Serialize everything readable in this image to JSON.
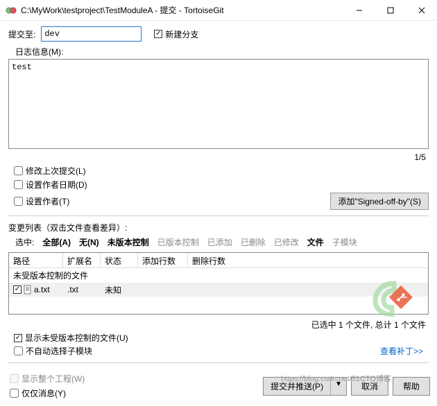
{
  "window": {
    "title": "C:\\MyWork\\testproject\\TestModuleA - 提交 - TortoiseGit"
  },
  "form": {
    "commit_to_label": "提交至:",
    "commit_to_value": "dev",
    "new_branch_label": "新建分支",
    "log_msg_label": "日志信息(M):",
    "commit_msg": "test",
    "counter": "1/5",
    "amend_label": "修改上次提交(L)",
    "set_author_date_label": "设置作者日期(D)",
    "set_author_label": "设置作者(T)",
    "signed_off_btn": "添加\"Signed-off-by\"(S)"
  },
  "changes": {
    "section_label": "变更列表（双击文件查看差异）:",
    "select_label": "选中:",
    "filters": {
      "all": "全部(A)",
      "none": "无(N)",
      "unversioned": "未版本控制",
      "versioned": "已版本控制",
      "added": "已添加",
      "deleted": "已删除",
      "modified": "已修改",
      "files": "文件",
      "submodules": "子模块"
    },
    "columns": {
      "path": "路径",
      "ext": "扩展名",
      "status": "状态",
      "added_lines": "添加行数",
      "deleted_lines": "删除行数"
    },
    "group": "未受版本控制的文件",
    "rows": [
      {
        "name": "a.txt",
        "ext": ".txt",
        "status": "未知"
      }
    ],
    "status_text": "已选中 1 个文件, 总计 1 个文件",
    "show_unversioned_label": "显示未受版本控制的文件(U)",
    "no_auto_select_submod_label": "不自动选择子模块",
    "view_patch_link": "查看补丁>>"
  },
  "footer": {
    "show_whole_project_label": "显示整个工程(W)",
    "msg_only_label": "仅仅消息(Y)",
    "commit_push_btn": "提交并推送(P)",
    "commit_push_arrow": "▼",
    "cancel_btn": "取消",
    "help_btn": "帮助"
  },
  "watermark_faded": "https://blog.csdn.net/51CTO博客"
}
